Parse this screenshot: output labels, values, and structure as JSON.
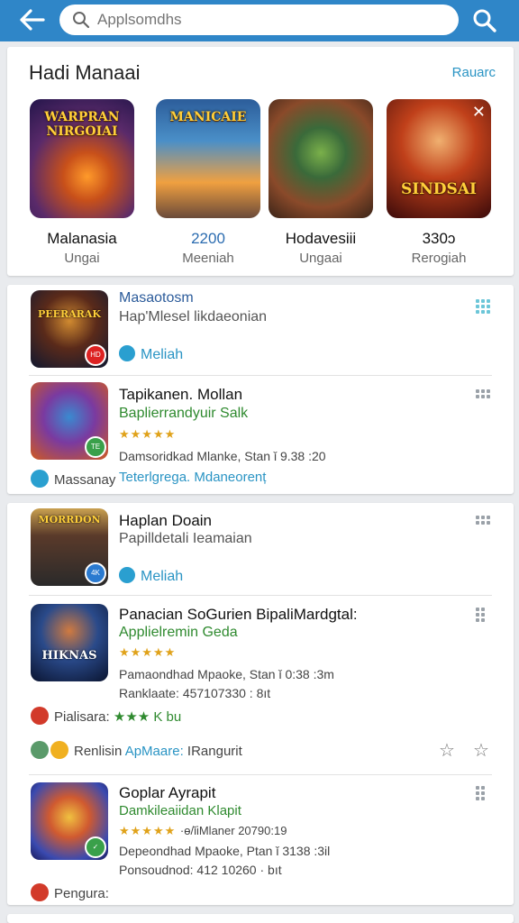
{
  "search": {
    "placeholder": "Applsomdhs"
  },
  "icons": {
    "back": "back-arrow-icon",
    "search": "search-icon",
    "more": "more-vert-icon"
  },
  "colors": {
    "topbar": "#2f86c8",
    "link": "#2a94c4",
    "green": "#2f8a2f",
    "star": "#e0a21a"
  },
  "featured": {
    "title": "Hadi Manaai",
    "more": "Rauarc",
    "items": [
      {
        "art": "WARPRAN NIRGOIAI",
        "name": "Malanasia",
        "sub": "Ungai"
      },
      {
        "art": "MANICAIE",
        "name": "2200",
        "sub": "Meeniah"
      },
      {
        "art": "",
        "name": "Hodavesiii",
        "sub": "Ungaai"
      },
      {
        "art": "SINDSAI",
        "name": "330ɔ",
        "sub": "Rerogiah"
      }
    ]
  },
  "list1": {
    "rows": [
      {
        "icon_label": "PEERARAK",
        "title": "Masaotosm",
        "subtitle": "Hap'Mlesel likdaeonian",
        "link": "Meliah"
      },
      {
        "title": "Tapikanen. Mollan",
        "subtitle": "Baplierrandyuir Salk",
        "stars": "★★★★★",
        "meta": "Damsoridkad Mlanke, Stan ǐ 9.38 :20",
        "footer_left": "Massanay",
        "footer_link": "Teterlgrega. Mdaneorenț"
      }
    ]
  },
  "list2": {
    "rows": [
      {
        "icon_label": "MORRDON",
        "title": "Haplan Doain",
        "subtitle": "Papilldetali Ieamaian",
        "link": "Meliah"
      },
      {
        "icon_label": "HIKNAS",
        "title": "Panacian SoGurien BipaliMardgtal:",
        "subtitle": "Applielremin Geda",
        "stars": "★★★★★",
        "meta1": "Pamaondhad Mpaoke, Stan ǐ 0:38 :3m",
        "meta2": "Ranklaate: 457107330 : 8ıt",
        "footer_left": "Pialisara:",
        "footer_stars": "★★★ K bu"
      },
      {
        "footer_left": "Renlisin",
        "footer_link": "ApMaare:",
        "footer_right": "IRangurit"
      },
      {
        "title": "Goplar Ayrapit",
        "subtitle": "Damkileaiidan Klapit",
        "stars": "★★★★★",
        "stars_extra": "·ɵ/ǐiMlaner 20790:19",
        "meta1": "Depeondhad Mpaoke, Ptan ǐ 3138 :3il",
        "meta2": "Ponsoudnod: 412 10260 · bıt",
        "footer_left": "Pengura:"
      }
    ]
  }
}
